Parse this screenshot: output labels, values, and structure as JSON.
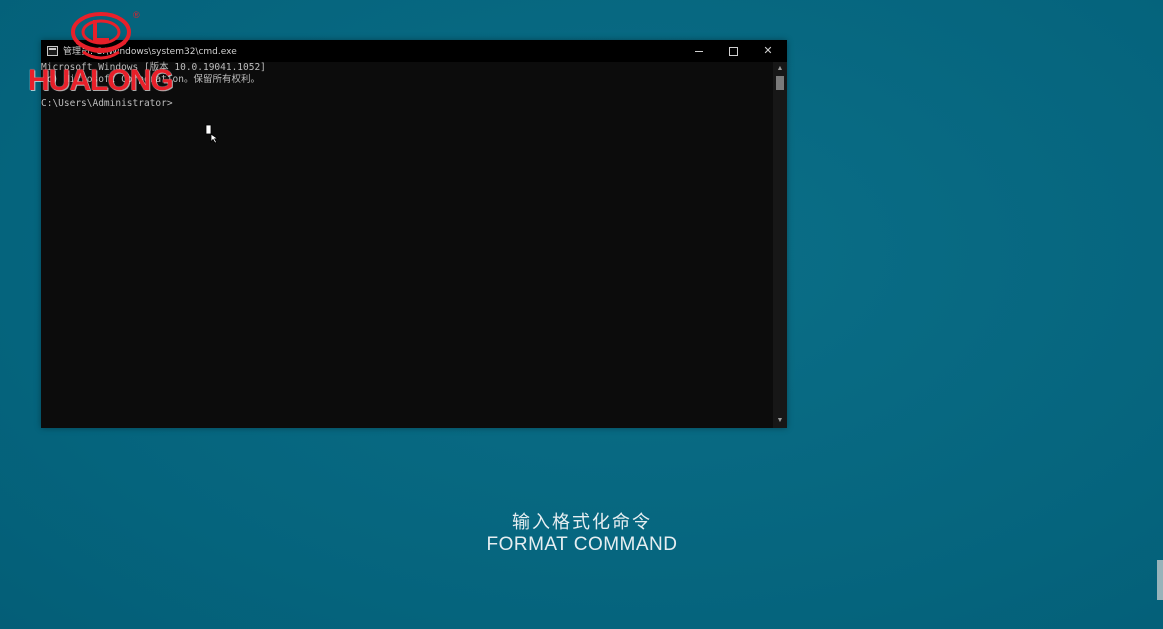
{
  "colors": {
    "desktop_background": "#006a85",
    "console_background": "#0c0c0c",
    "console_text": "#bdbdbd",
    "logo_red": "#e8202a",
    "caption_text": "#e6eef1"
  },
  "cmd_window": {
    "title": "管理员: C:\\Windows\\system32\\cmd.exe",
    "minimize_icon": "minimize-icon",
    "maximize_icon": "maximize-icon",
    "close_label": "✕",
    "console_lines": [
      "Microsoft Windows [版本 10.0.19041.1052]",
      "(c) Microsoft Corporation。保留所有权利。",
      "C:\\Users\\Administrator>"
    ],
    "scroll_up": "▲",
    "scroll_down": "▼"
  },
  "logo": {
    "text": "HUALONG",
    "registered_mark": "®"
  },
  "caption": {
    "chinese": "输入格式化命令",
    "english": "FORMAT COMMAND"
  }
}
